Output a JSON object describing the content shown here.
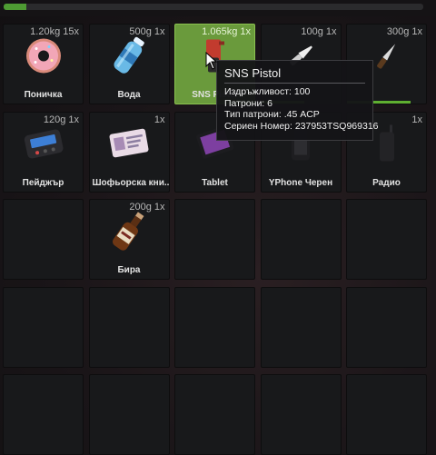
{
  "weight_bar": {
    "fill_fraction": 0.055,
    "color": "#4e9b33"
  },
  "inventory": {
    "slots": [
      {
        "meta": "1.20kg 15x",
        "label": "Поничка",
        "icon": "donut-icon"
      },
      {
        "meta": "500g 1x",
        "label": "Вода",
        "icon": "water-bottle-icon"
      },
      {
        "meta": "1.065kg 1x",
        "label": "SNS Pistol",
        "icon": "pistol-icon",
        "selected": true
      },
      {
        "meta": "100g 1x",
        "label": "",
        "icon": "knife-icon",
        "bar": 0.55
      },
      {
        "meta": "300g 1x",
        "label": "",
        "icon": "blade-icon",
        "bar": 0.8
      },
      {
        "meta": "120g 1x",
        "label": "Пейджър",
        "icon": "pager-icon"
      },
      {
        "meta": "1x",
        "label": "Шофьорска кни...",
        "icon": "drivers-license-icon"
      },
      {
        "meta": "",
        "label": "Tablet",
        "icon": "tablet-icon"
      },
      {
        "meta": "",
        "label": "YPhone Черен",
        "icon": "phone-icon"
      },
      {
        "meta": "1x",
        "label": "Радио",
        "icon": "radio-icon"
      },
      {
        "meta": "",
        "label": "",
        "icon": ""
      },
      {
        "meta": "200g 1x",
        "label": "Бира",
        "icon": "beer-bottle-icon"
      },
      {
        "meta": "",
        "label": "",
        "icon": ""
      },
      {
        "meta": "",
        "label": "",
        "icon": ""
      },
      {
        "meta": "",
        "label": "",
        "icon": ""
      },
      {
        "meta": "",
        "label": "",
        "icon": ""
      },
      {
        "meta": "",
        "label": "",
        "icon": ""
      },
      {
        "meta": "",
        "label": "",
        "icon": ""
      },
      {
        "meta": "",
        "label": "",
        "icon": ""
      },
      {
        "meta": "",
        "label": "",
        "icon": ""
      },
      {
        "meta": "",
        "label": "",
        "icon": ""
      },
      {
        "meta": "",
        "label": "",
        "icon": ""
      },
      {
        "meta": "",
        "label": "",
        "icon": ""
      },
      {
        "meta": "",
        "label": "",
        "icon": ""
      },
      {
        "meta": "",
        "label": "",
        "icon": ""
      }
    ]
  },
  "tooltip": {
    "title": "SNS Pistol",
    "lines": [
      "Издръжливост: 100",
      "Патрони: 6",
      "Тип патрони: .45 ACP",
      "Сериен Номер: 237953TSQ969316"
    ]
  }
}
